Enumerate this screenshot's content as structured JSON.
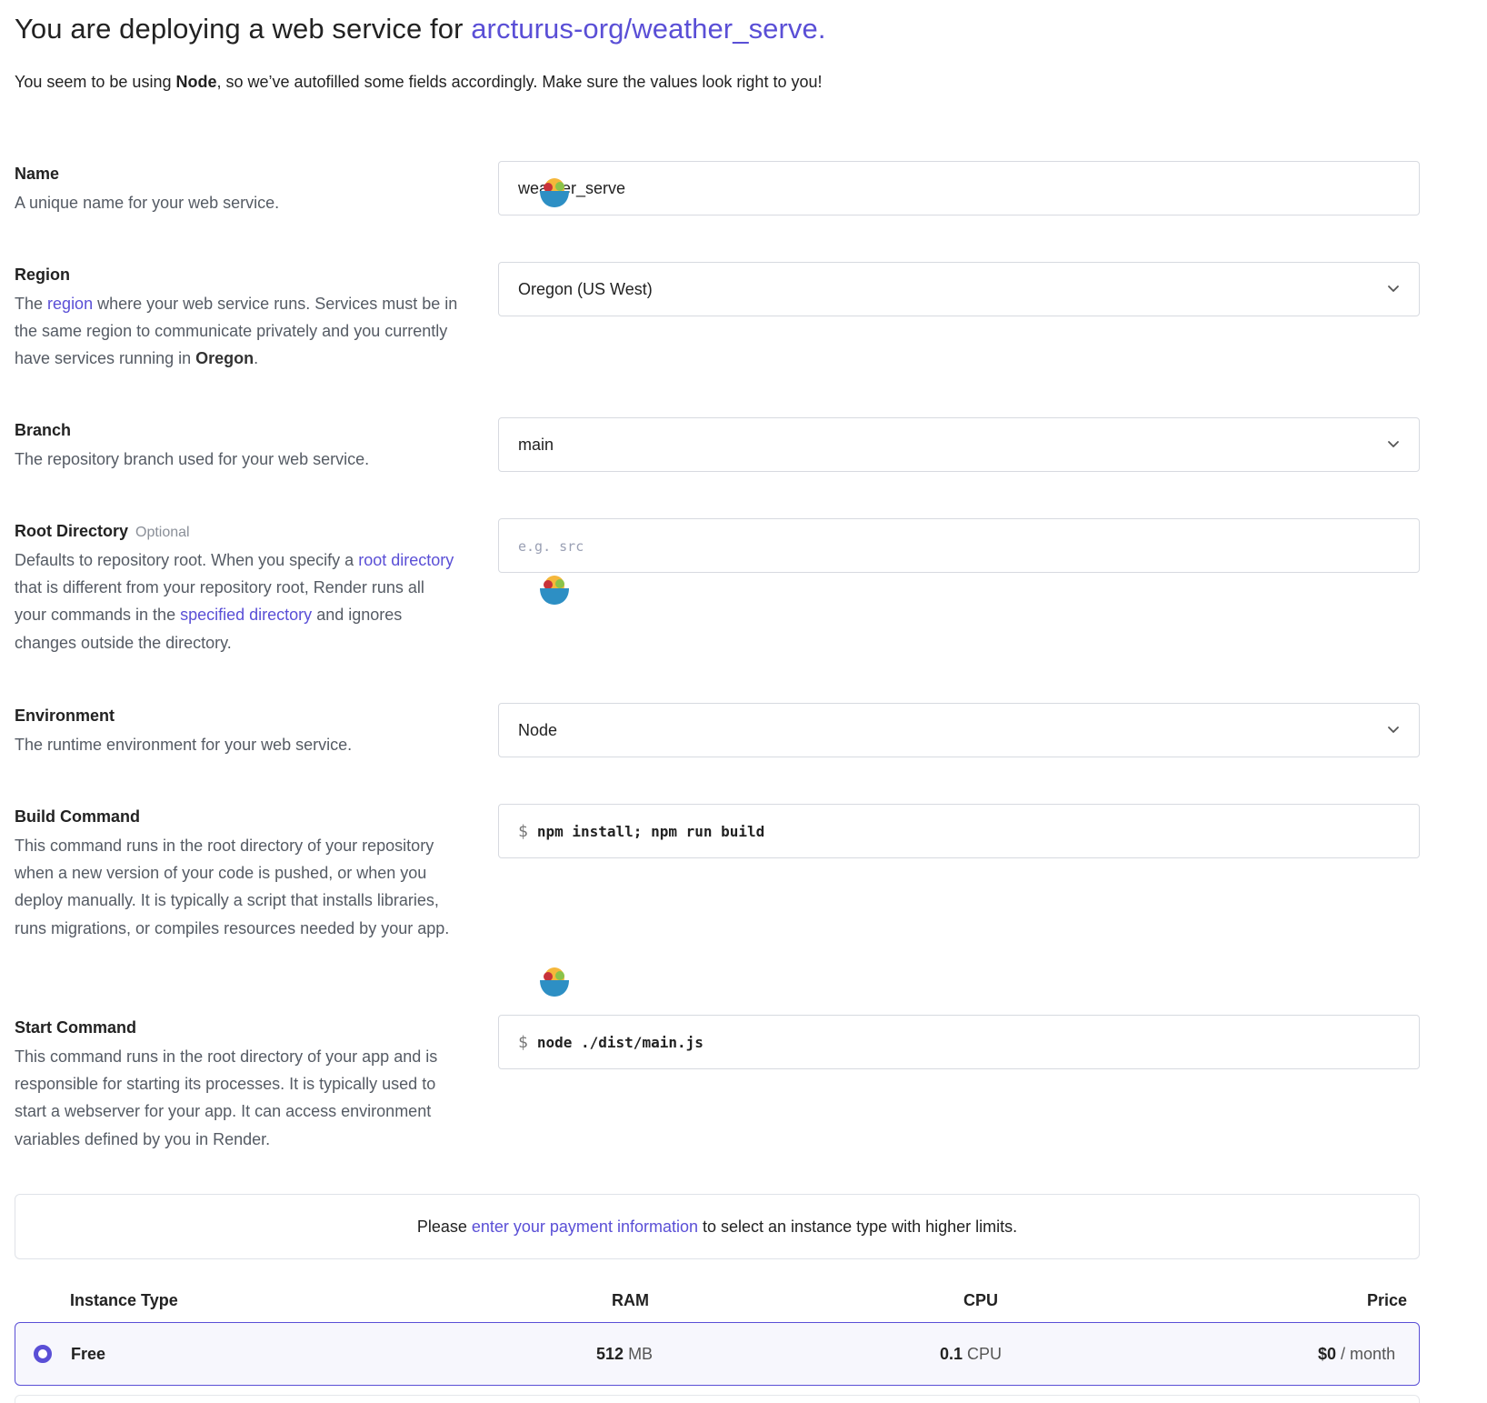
{
  "header": {
    "title_prefix": "You are deploying a web service for",
    "repo": "arcturus-org/weather_serve."
  },
  "intro": {
    "prefix": "You seem to be using",
    "env": "Node",
    "suffix": ", so we’ve autofilled some fields accordingly. Make sure the values look right to you!"
  },
  "name": {
    "label": "Name",
    "desc": "A unique name for your web service.",
    "value": "weather_serve"
  },
  "region": {
    "label": "Region",
    "desc_1": "The",
    "desc_link": "region",
    "desc_2": "where your web service runs. Services must be in the same region to communicate privately and you currently have services running in",
    "desc_bold": "Oregon",
    "desc_end": ".",
    "value": "Oregon (US West)"
  },
  "branch": {
    "label": "Branch",
    "desc": "The repository branch used for your web service.",
    "value": "main"
  },
  "root_directory": {
    "label": "Root Directory",
    "optional": "Optional",
    "desc_1": "Defaults to repository root. When you specify a",
    "link_1": "root directory",
    "desc_2": "that is different from your repository root, Render runs all your commands in the",
    "link_2": "specified directory",
    "desc_3": "and ignores changes outside the directory.",
    "placeholder": "e.g. src"
  },
  "environment": {
    "label": "Environment",
    "desc": "The runtime environment for your web service.",
    "value": "Node"
  },
  "build_command": {
    "label": "Build Command",
    "desc": "This command runs in the root directory of your repository when a new version of your code is pushed, or when you deploy manually. It is typically a script that installs libraries, runs migrations, or compiles resources needed by your app.",
    "prompt": "$",
    "value": "npm install; npm run build"
  },
  "start_command": {
    "label": "Start Command",
    "desc": "This command runs in the root directory of your app and is responsible for starting its processes. It is typically used to start a webserver for your app. It can access environment variables defined by you in Render.",
    "prompt": "$",
    "value": "node ./dist/main.js"
  },
  "notice": {
    "prefix": "Please",
    "link": "enter your payment information",
    "suffix": "to select an instance type with higher limits."
  },
  "instance_table": {
    "headers": {
      "type": "Instance Type",
      "ram": "RAM",
      "cpu": "CPU",
      "price": "Price"
    },
    "rows": [
      {
        "type": "Free",
        "ram_value": "512",
        "ram_unit": "MB",
        "cpu_value": "0.1",
        "cpu_unit": "CPU",
        "price_value": "$0",
        "price_unit": "/ month",
        "selected": true
      }
    ]
  },
  "colors": {
    "accent": "#5a4fd6",
    "border": "#d7dae0",
    "muted_text": "#555b64"
  },
  "icons": [
    "chevron-down-icon",
    "bowl-icon",
    "radio-selected-icon"
  ]
}
